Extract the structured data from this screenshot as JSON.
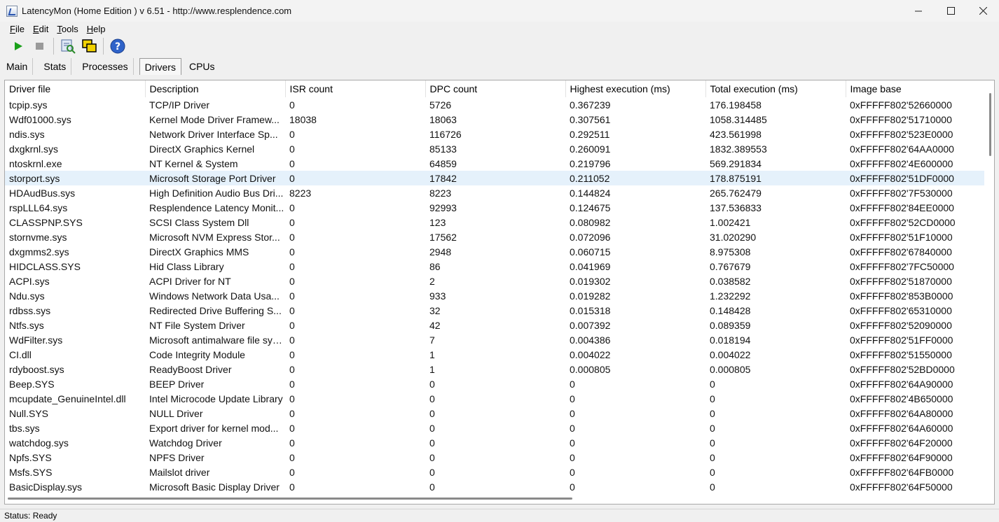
{
  "window": {
    "title": "LatencyMon  (Home Edition )  v 6.51 - http://www.resplendence.com",
    "minimize_icon": "minimize-icon",
    "maximize_icon": "maximize-icon",
    "close_icon": "close-icon"
  },
  "menu": {
    "items": [
      {
        "first": "F",
        "rest": "ile"
      },
      {
        "first": "E",
        "rest": "dit"
      },
      {
        "first": "T",
        "rest": "ools"
      },
      {
        "first": "H",
        "rest": "elp"
      }
    ]
  },
  "toolbar": {
    "buttons": [
      "play-icon",
      "stop-icon",
      "report-icon",
      "windows-icon",
      "help-icon"
    ],
    "accent": "#1aa01a"
  },
  "tabs": {
    "items": [
      "Main",
      "Stats",
      "Processes",
      "Drivers",
      "CPUs"
    ],
    "active": "Drivers"
  },
  "table": {
    "columns": [
      "Driver file",
      "Description",
      "ISR count",
      "DPC count",
      "Highest execution (ms)",
      "Total execution (ms)",
      "Image base"
    ],
    "selected_row": 5,
    "rows": [
      [
        "tcpip.sys",
        "TCP/IP Driver",
        "0",
        "5726",
        "0.367239",
        "176.198458",
        "0xFFFFF802'52660000"
      ],
      [
        "Wdf01000.sys",
        "Kernel Mode Driver Framew...",
        "18038",
        "18063",
        "0.307561",
        "1058.314485",
        "0xFFFFF802'51710000"
      ],
      [
        "ndis.sys",
        "Network Driver Interface Sp...",
        "0",
        "116726",
        "0.292511",
        "423.561998",
        "0xFFFFF802'523E0000"
      ],
      [
        "dxgkrnl.sys",
        "DirectX Graphics Kernel",
        "0",
        "85133",
        "0.260091",
        "1832.389553",
        "0xFFFFF802'64AA0000"
      ],
      [
        "ntoskrnl.exe",
        "NT Kernel & System",
        "0",
        "64859",
        "0.219796",
        "569.291834",
        "0xFFFFF802'4E600000"
      ],
      [
        "storport.sys",
        "Microsoft Storage Port Driver",
        "0",
        "17842",
        "0.211052",
        "178.875191",
        "0xFFFFF802'51DF0000"
      ],
      [
        "HDAudBus.sys",
        "High Definition Audio Bus Dri...",
        "8223",
        "8223",
        "0.144824",
        "265.762479",
        "0xFFFFF802'7F530000"
      ],
      [
        "rspLLL64.sys",
        "Resplendence Latency Monit...",
        "0",
        "92993",
        "0.124675",
        "137.536833",
        "0xFFFFF802'84EE0000"
      ],
      [
        "CLASSPNP.SYS",
        "SCSI Class System Dll",
        "0",
        "123",
        "0.080982",
        "1.002421",
        "0xFFFFF802'52CD0000"
      ],
      [
        "stornvme.sys",
        "Microsoft NVM Express Stor...",
        "0",
        "17562",
        "0.072096",
        "31.020290",
        "0xFFFFF802'51F10000"
      ],
      [
        "dxgmms2.sys",
        "DirectX Graphics MMS",
        "0",
        "2948",
        "0.060715",
        "8.975308",
        "0xFFFFF802'67840000"
      ],
      [
        "HIDCLASS.SYS",
        "Hid Class Library",
        "0",
        "86",
        "0.041969",
        "0.767679",
        "0xFFFFF802'7FC50000"
      ],
      [
        "ACPI.sys",
        "ACPI Driver for NT",
        "0",
        "2",
        "0.019302",
        "0.038582",
        "0xFFFFF802'51870000"
      ],
      [
        "Ndu.sys",
        "Windows Network Data Usa...",
        "0",
        "933",
        "0.019282",
        "1.232292",
        "0xFFFFF802'853B0000"
      ],
      [
        "rdbss.sys",
        "Redirected Drive Buffering S...",
        "0",
        "32",
        "0.015318",
        "0.148428",
        "0xFFFFF802'65310000"
      ],
      [
        "Ntfs.sys",
        "NT File System Driver",
        "0",
        "42",
        "0.007392",
        "0.089359",
        "0xFFFFF802'52090000"
      ],
      [
        "WdFilter.sys",
        "Microsoft antimalware file sys...",
        "0",
        "7",
        "0.004386",
        "0.018194",
        "0xFFFFF802'51FF0000"
      ],
      [
        "CI.dll",
        "Code Integrity Module",
        "0",
        "1",
        "0.004022",
        "0.004022",
        "0xFFFFF802'51550000"
      ],
      [
        "rdyboost.sys",
        "ReadyBoost Driver",
        "0",
        "1",
        "0.000805",
        "0.000805",
        "0xFFFFF802'52BD0000"
      ],
      [
        "Beep.SYS",
        "BEEP Driver",
        "0",
        "0",
        "0",
        "0",
        "0xFFFFF802'64A90000"
      ],
      [
        "mcupdate_GenuineIntel.dll",
        "Intel Microcode Update Library",
        "0",
        "0",
        "0",
        "0",
        "0xFFFFF802'4B650000"
      ],
      [
        "Null.SYS",
        "NULL Driver",
        "0",
        "0",
        "0",
        "0",
        "0xFFFFF802'64A80000"
      ],
      [
        "tbs.sys",
        "Export driver for kernel mod...",
        "0",
        "0",
        "0",
        "0",
        "0xFFFFF802'64A60000"
      ],
      [
        "watchdog.sys",
        "Watchdog Driver",
        "0",
        "0",
        "0",
        "0",
        "0xFFFFF802'64F20000"
      ],
      [
        "Npfs.SYS",
        "NPFS Driver",
        "0",
        "0",
        "0",
        "0",
        "0xFFFFF802'64F90000"
      ],
      [
        "Msfs.SYS",
        "Mailslot driver",
        "0",
        "0",
        "0",
        "0",
        "0xFFFFF802'64FB0000"
      ],
      [
        "BasicDisplay.sys",
        "Microsoft Basic Display Driver",
        "0",
        "0",
        "0",
        "0",
        "0xFFFFF802'64F50000"
      ]
    ]
  },
  "status": {
    "text": "Status: Ready"
  }
}
